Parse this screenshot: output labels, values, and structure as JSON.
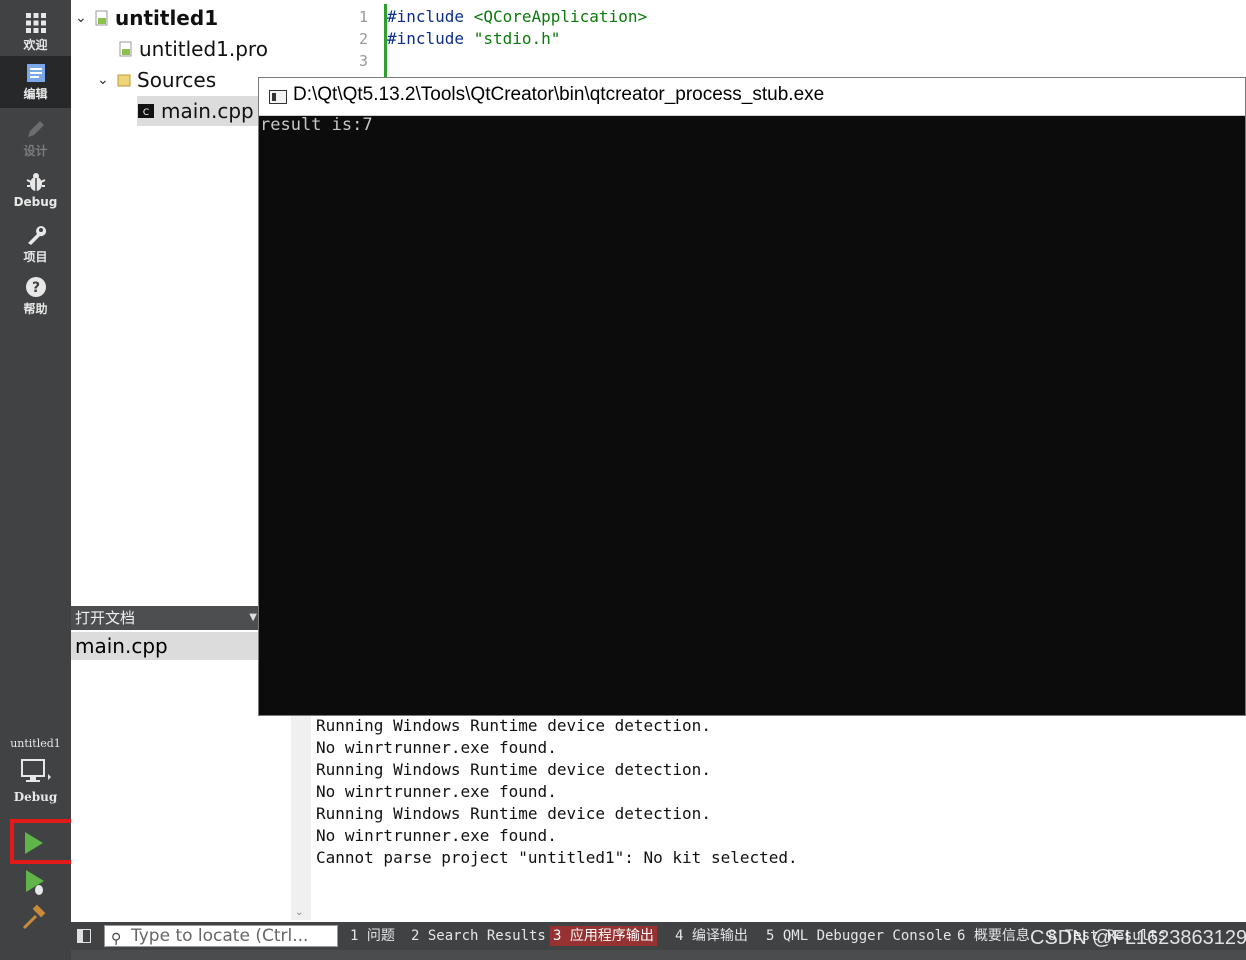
{
  "modes": [
    {
      "label": "欢迎",
      "icon": "grid-icon",
      "active": false
    },
    {
      "label": "编辑",
      "icon": "edit-doc-icon",
      "active": true
    },
    {
      "label": "设计",
      "icon": "pencil-icon",
      "active": false
    },
    {
      "label": "Debug",
      "icon": "bug-icon",
      "active": false
    },
    {
      "label": "项目",
      "icon": "wrench-icon",
      "active": false
    },
    {
      "label": "帮助",
      "icon": "help-icon",
      "active": false
    }
  ],
  "kit": {
    "project": "untitled1",
    "build_config": "Debug"
  },
  "project_tree": {
    "project": "untitled1",
    "pro_file": "untitled1.pro",
    "sources_folder": "Sources",
    "source_file": "main.cpp"
  },
  "open_documents": {
    "header": "打开文档",
    "items": [
      "main.cpp"
    ]
  },
  "editor": {
    "line_numbers": [
      "1",
      "2",
      "3"
    ],
    "lines": [
      {
        "keyword": "#include",
        "arg": "<QCoreApplication>"
      },
      {
        "keyword": "#include",
        "arg": "\"stdio.h\""
      }
    ]
  },
  "console": {
    "title": "D:\\Qt\\Qt5.13.2\\Tools\\QtCreator\\bin\\qtcreator_process_stub.exe",
    "lines": [
      "result is:7"
    ]
  },
  "app_output": {
    "lines": [
      "Running Windows Runtime device detection.",
      "No winrtrunner.exe found.",
      "Running Windows Runtime device detection.",
      "No winrtrunner.exe found.",
      "Running Windows Runtime device detection.",
      "No winrtrunner.exe found.",
      "Cannot parse project \"untitled1\": No kit selected."
    ]
  },
  "statusbar": {
    "locator_placeholder": "Type to locate (Ctrl...",
    "tabs": [
      {
        "label": "1 问题",
        "active": false
      },
      {
        "label": "2 Search Results",
        "active": false
      },
      {
        "label": "3 应用程序输出",
        "active": true
      },
      {
        "label": "4 编译输出",
        "active": false
      },
      {
        "label": "5 QML Debugger Console",
        "active": false
      },
      {
        "label": "6 概要信息",
        "active": false
      },
      {
        "label": "8 Test Results",
        "active": false
      }
    ]
  },
  "watermark": "CSDN @FL1623863129",
  "colors": {
    "highlight": "#e41a1a",
    "active_tab": "#963232",
    "run_green": "#5fb548"
  }
}
